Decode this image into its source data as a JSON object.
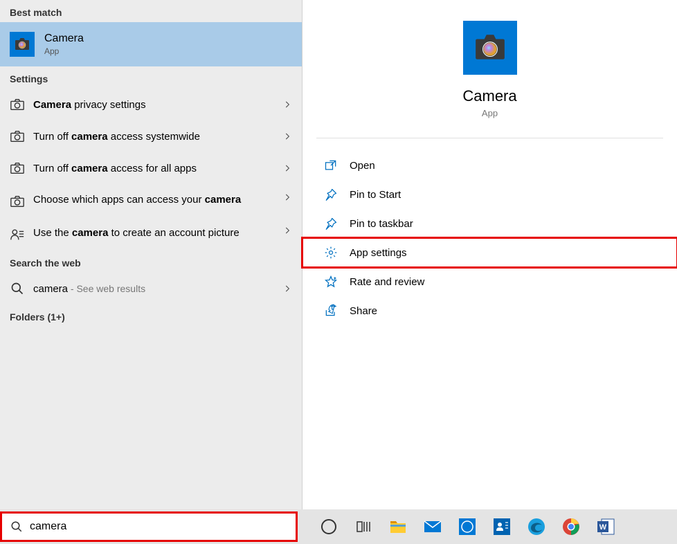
{
  "left": {
    "bestMatchHeader": "Best match",
    "bestMatch": {
      "title": "Camera",
      "subtitle": "App"
    },
    "settingsHeader": "Settings",
    "settingsItems": [
      {
        "pre": "",
        "bold": "Camera",
        "post": " privacy settings"
      },
      {
        "pre": "Turn off ",
        "bold": "camera",
        "post": " access systemwide"
      },
      {
        "pre": "Turn off ",
        "bold": "camera",
        "post": " access for all apps"
      },
      {
        "pre": "Choose which apps can access your ",
        "bold": "camera",
        "post": ""
      },
      {
        "pre": "Use the ",
        "bold": "camera",
        "post": " to create an account picture"
      }
    ],
    "webHeader": "Search the web",
    "webItem": {
      "term": "camera",
      "suffix": " - See web results"
    },
    "foldersHeader": "Folders (1+)"
  },
  "right": {
    "title": "Camera",
    "subtitle": "App",
    "actions": [
      {
        "label": "Open",
        "icon": "open"
      },
      {
        "label": "Pin to Start",
        "icon": "pin"
      },
      {
        "label": "Pin to taskbar",
        "icon": "pin"
      },
      {
        "label": "App settings",
        "icon": "gear",
        "hl": true
      },
      {
        "label": "Rate and review",
        "icon": "star"
      },
      {
        "label": "Share",
        "icon": "share"
      }
    ]
  },
  "search": {
    "value": "camera"
  }
}
